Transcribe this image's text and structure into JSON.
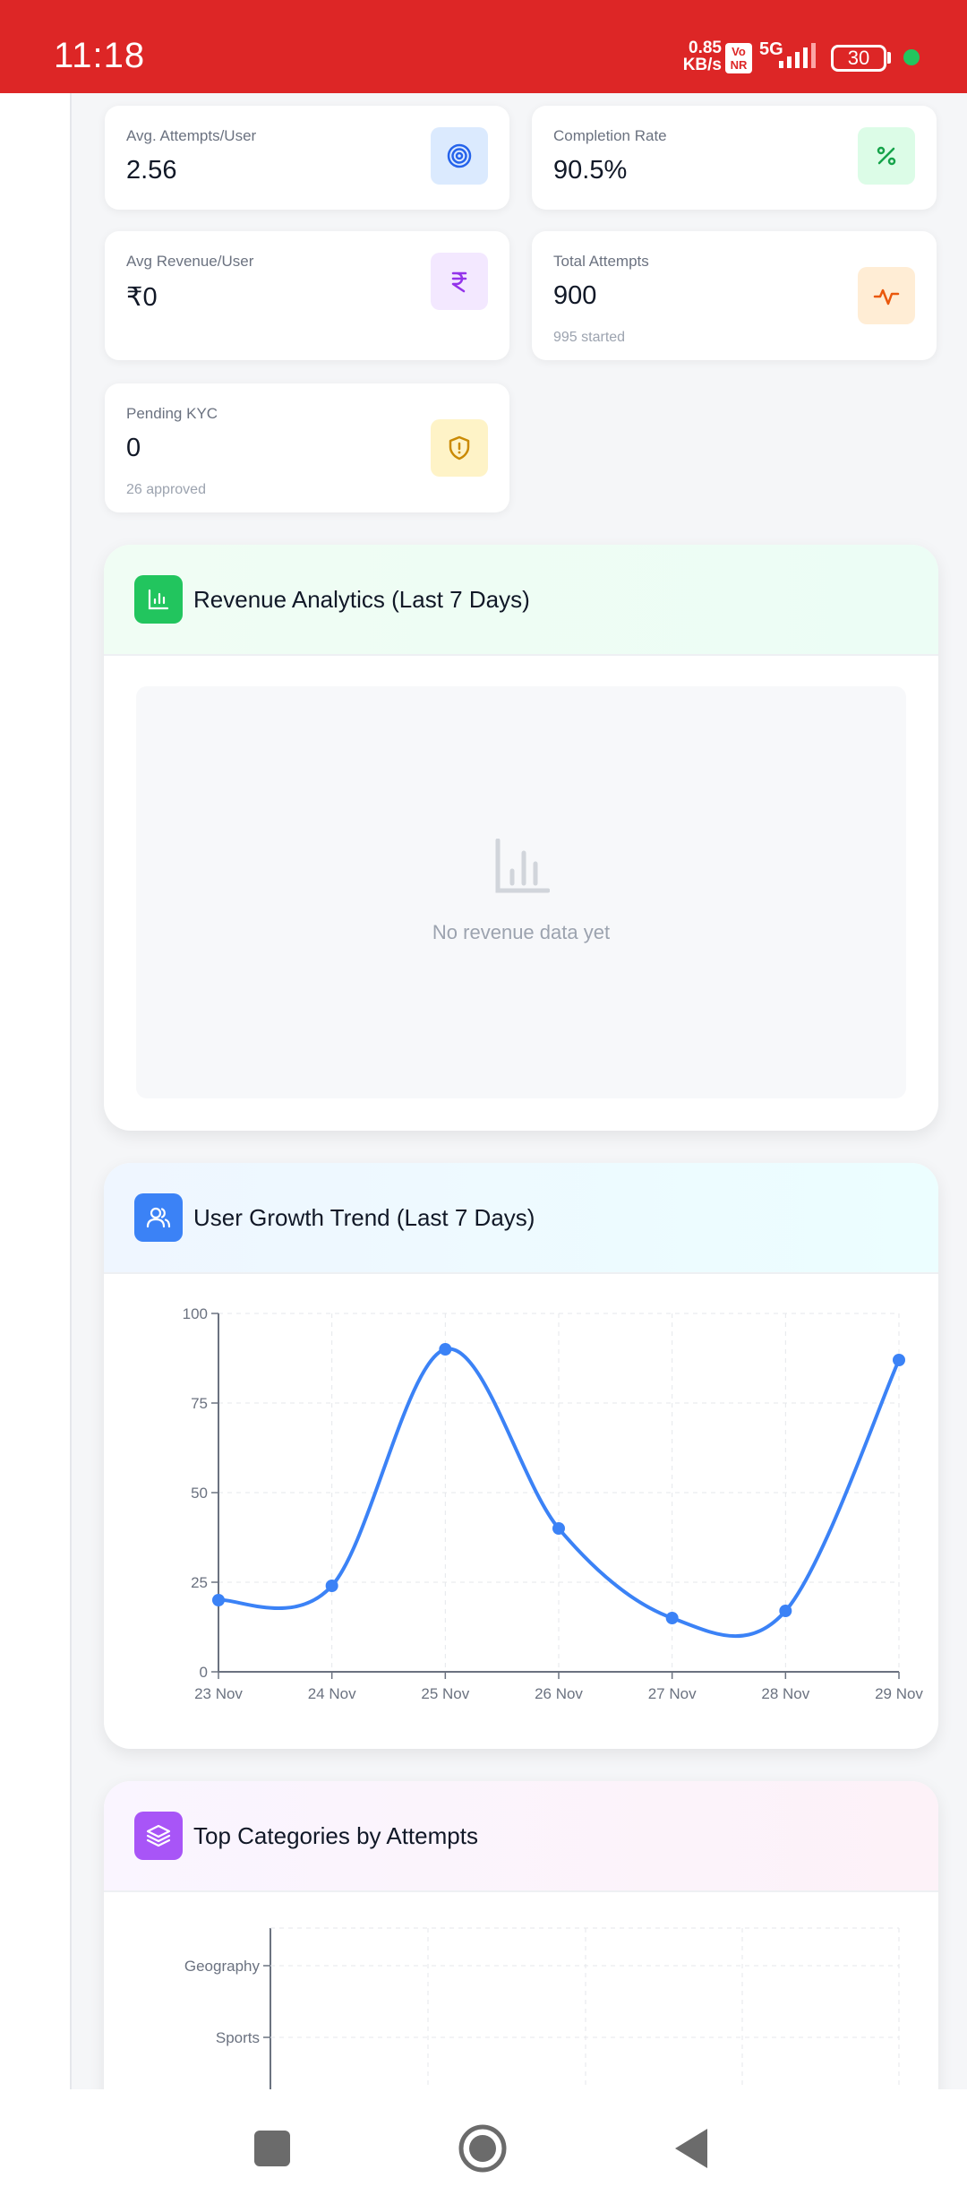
{
  "status_bar": {
    "time": "11:18",
    "net_speed_value": "0.85",
    "net_speed_unit": "KB/s",
    "volte_top": "Vo",
    "volte_bottom": "NR",
    "network_type": "5G",
    "battery": "30",
    "dot_color": "#22c55e"
  },
  "stats": [
    {
      "label": "Avg. Attempts/User",
      "value": "2.56",
      "sub": "",
      "icon": "target-icon",
      "icon_bg": "#dbeafe",
      "icon_color": "#2563eb"
    },
    {
      "label": "Completion Rate",
      "value": "90.5%",
      "sub": "",
      "icon": "percent-icon",
      "icon_bg": "#dcfce7",
      "icon_color": "#16a34a"
    },
    {
      "label": "Avg Revenue/User",
      "value": "₹0",
      "sub": "",
      "icon": "rupee-icon",
      "icon_bg": "#f3e8ff",
      "icon_color": "#9333ea"
    },
    {
      "label": "Total Attempts",
      "value": "900",
      "sub": "995 started",
      "icon": "activity-icon",
      "icon_bg": "#ffedd5",
      "icon_color": "#ea580c"
    },
    {
      "label": "Pending KYC",
      "value": "0",
      "sub": "26 approved",
      "icon": "shield-alert-icon",
      "icon_bg": "#fef3c7",
      "icon_color": "#ca8a04"
    }
  ],
  "revenue": {
    "title": "Revenue Analytics (Last 7 Days)",
    "empty_text": "No revenue data yet",
    "header_icon": "bar-chart-icon",
    "accent": "#22c55e"
  },
  "growth": {
    "title": "User Growth Trend (Last 7 Days)",
    "header_icon": "users-icon",
    "accent": "#3b82f6"
  },
  "categories": {
    "title": "Top Categories by Attempts",
    "header_icon": "layers-icon",
    "accent": "#a855f7"
  },
  "chart_data": [
    {
      "type": "line",
      "title": "User Growth Trend (Last 7 Days)",
      "x": [
        "23 Nov",
        "24 Nov",
        "25 Nov",
        "26 Nov",
        "27 Nov",
        "28 Nov",
        "29 Nov"
      ],
      "series": [
        {
          "values": [
            20,
            24,
            90,
            40,
            15,
            17,
            87
          ]
        }
      ],
      "yticks": [
        "0",
        "25",
        "50",
        "75",
        "100"
      ],
      "ylim": [
        0,
        100
      ],
      "grid": true,
      "color": "#3b82f6"
    },
    {
      "type": "bar",
      "title": "Top Categories by Attempts",
      "orientation": "horizontal",
      "categories": [
        "Geography",
        "Sports"
      ],
      "grid": true
    }
  ]
}
